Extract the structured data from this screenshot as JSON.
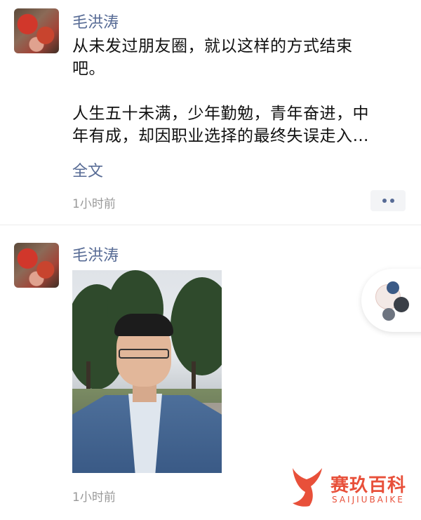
{
  "posts": [
    {
      "author": "毛洪涛",
      "content_lines": [
        "从未发过朋友圈，就以这样的方式结束",
        "吧。",
        "人生五十未满，少年勤勉，青年奋进，中",
        "年有成，却因职业选择的最终失误走入…"
      ],
      "full_text_link": "全文",
      "time": "1小时前",
      "more_icon": "dots-icon"
    },
    {
      "author": "毛洪涛",
      "photo_icon": "selfie-photo",
      "time": "1小时前"
    }
  ],
  "watermark": {
    "cn": "赛玖百科",
    "en": "SAIJIUBAIKE"
  },
  "colors": {
    "link": "#576b95",
    "text": "#111111",
    "time": "#999999",
    "watermark": "#e8503a"
  }
}
